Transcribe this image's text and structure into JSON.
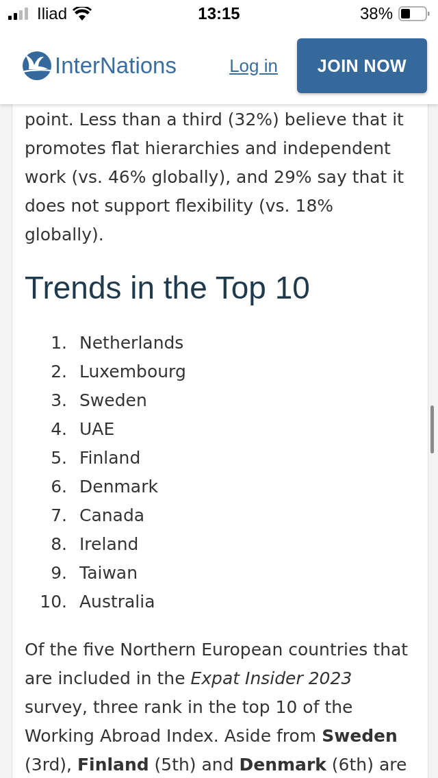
{
  "status_bar": {
    "carrier": "Iliad",
    "time": "13:15",
    "battery": "38%"
  },
  "header": {
    "logo": "InterNations",
    "login": "Log in",
    "join": "JOIN NOW"
  },
  "article": {
    "intro": "point. Less than a third (32%) believe that it promotes flat hierarchies and independent work (vs. 46% globally), and 29% say that it does not support flexibility (vs. 18% globally).",
    "heading": "Trends in the Top 10",
    "ranking": [
      {
        "number": "1.",
        "country": "Netherlands"
      },
      {
        "number": "2.",
        "country": "Luxembourg"
      },
      {
        "number": "3.",
        "country": "Sweden"
      },
      {
        "number": "4.",
        "country": "UAE"
      },
      {
        "number": "5.",
        "country": "Finland"
      },
      {
        "number": "6.",
        "country": "Denmark"
      },
      {
        "number": "7.",
        "country": "Canada"
      },
      {
        "number": "8.",
        "country": "Ireland"
      },
      {
        "number": "9.",
        "country": "Taiwan"
      },
      {
        "number": "10.",
        "country": "Australia"
      }
    ],
    "paragraph": "Of the five Northern European countries that are included in the *Expat Insider 2023* survey, three rank in the top 10 of the Working Abroad Index. Aside from **Sweden** (3rd), **Finland** (5th) and **Denmark** (6th) are"
  }
}
